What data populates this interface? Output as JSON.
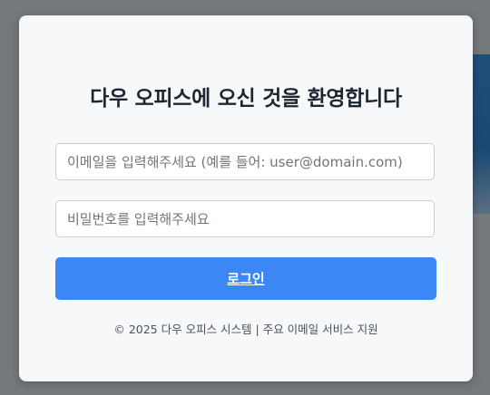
{
  "login": {
    "title": "다우 오피스에 오신 것을 환영합니다",
    "email_placeholder": "이메일을 입력해주세요 (예를 들어: user@domain.com)",
    "email_value": "",
    "password_placeholder": "비밀번호를 입력해주세요",
    "password_value": "",
    "login_button_label": "로그인",
    "footer_text": "© 2025 다우 오피스 시스템 | 주요 이메일 서비스 지원"
  },
  "colors": {
    "backdrop": "#75797c",
    "card_background": "#f7f8f9",
    "accent": "#3b87f5",
    "title_text": "#1d2733"
  }
}
